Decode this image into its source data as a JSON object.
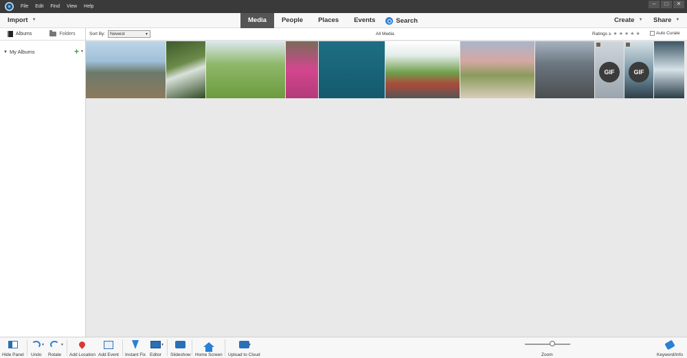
{
  "menu": [
    "File",
    "Edit",
    "Find",
    "View",
    "Help"
  ],
  "window_controls": [
    "–",
    "□",
    "✕"
  ],
  "topnav": {
    "import_label": "Import",
    "tabs": [
      "Media",
      "People",
      "Places",
      "Events"
    ],
    "search_label": "Search",
    "create_label": "Create",
    "share_label": "Share"
  },
  "left_panel": {
    "albums_label": "Albums",
    "folders_label": "Folders",
    "my_albums_label": "My Albums",
    "add_symbol": "+"
  },
  "content_header": {
    "sort_by_label": "Sort By:",
    "sort_value": "Newest",
    "view_title": "All Media",
    "ratings_label": "Ratings ≥",
    "stars": "★★★★★",
    "auto_curate_label": "Auto Curate"
  },
  "thumbnails": [
    {
      "type": "photo"
    },
    {
      "type": "photo"
    },
    {
      "type": "photo"
    },
    {
      "type": "photo"
    },
    {
      "type": "photo"
    },
    {
      "type": "photo"
    },
    {
      "type": "photo"
    },
    {
      "type": "photo"
    },
    {
      "type": "gif",
      "badge": "GIF"
    },
    {
      "type": "gif",
      "badge": "GIF"
    },
    {
      "type": "photo"
    }
  ],
  "bottombar": {
    "hide_panel": "Hide Panel",
    "undo": "Undo",
    "rotate": "Rotate",
    "add_location": "Add Location",
    "add_event": "Add Event",
    "instant_fix": "Instant Fix",
    "editor": "Editor",
    "slideshow": "Slideshow",
    "home_screen": "Home Screen",
    "upload_to_cloud": "Upload to Cloud",
    "zoom": "Zoom",
    "keyword_info": "Keyword/Info"
  },
  "colors": {
    "accent": "#2a7fd6",
    "active_tab_bg": "#555555",
    "add_green": "#3aa335"
  }
}
